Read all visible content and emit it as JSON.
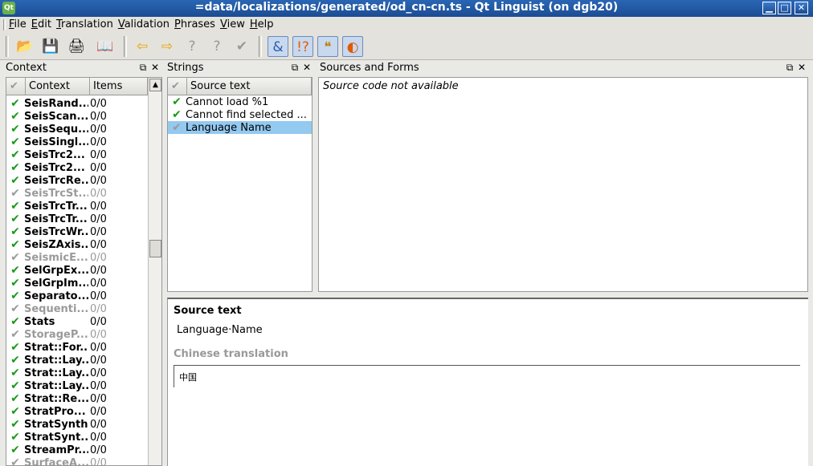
{
  "window": {
    "title": "=data/localizations/generated/od_cn-cn.ts - Qt Linguist (on dgb20)",
    "logo": "Qt"
  },
  "menu": [
    {
      "label": "File",
      "underline": "F",
      "rest": "ile"
    },
    {
      "label": "Edit",
      "underline": "E",
      "rest": "dit"
    },
    {
      "label": "Translation",
      "underline": "T",
      "rest": "ranslation"
    },
    {
      "label": "Validation",
      "underline": "V",
      "rest": "alidation"
    },
    {
      "label": "Phrases",
      "underline": "P",
      "rest": "hrases"
    },
    {
      "label": "View",
      "underline": "V",
      "rest": "iew"
    },
    {
      "label": "Help",
      "underline": "H",
      "rest": "elp"
    }
  ],
  "toolbar_icons": [
    "open-icon",
    "save-icon",
    "print-icon",
    "phrasebook-icon",
    "prev-icon",
    "next-icon",
    "prev-unfinished-icon",
    "next-unfinished-icon",
    "done-next-icon",
    "accelerators-icon",
    "punctuation-icon",
    "phrase-matches-icon",
    "place-markers-icon"
  ],
  "context_panel": {
    "title": "Context",
    "col_context": "Context",
    "col_items": "Items",
    "rows": [
      {
        "name": "SeisRand...",
        "items": "0/0",
        "state": "done"
      },
      {
        "name": "SeisScan...",
        "items": "0/0",
        "state": "done"
      },
      {
        "name": "SeisSequ...",
        "items": "0/0",
        "state": "done"
      },
      {
        "name": "SeisSingl...",
        "items": "0/0",
        "state": "done"
      },
      {
        "name": "SeisTrc2...",
        "items": "0/0",
        "state": "done"
      },
      {
        "name": "SeisTrc2...",
        "items": "0/0",
        "state": "done"
      },
      {
        "name": "SeisTrcRe...",
        "items": "0/0",
        "state": "done"
      },
      {
        "name": "SeisTrcSt...",
        "items": "0/0",
        "state": "obsolete"
      },
      {
        "name": "SeisTrcTr...",
        "items": "0/0",
        "state": "done"
      },
      {
        "name": "SeisTrcTr...",
        "items": "0/0",
        "state": "done"
      },
      {
        "name": "SeisTrcWr...",
        "items": "0/0",
        "state": "done"
      },
      {
        "name": "SeisZAxis...",
        "items": "0/0",
        "state": "done"
      },
      {
        "name": "SeismicE...",
        "items": "0/0",
        "state": "obsolete"
      },
      {
        "name": "SelGrpEx...",
        "items": "0/0",
        "state": "done"
      },
      {
        "name": "SelGrpIm...",
        "items": "0/0",
        "state": "done"
      },
      {
        "name": "Separato...",
        "items": "0/0",
        "state": "done"
      },
      {
        "name": "Sequenti...",
        "items": "0/0",
        "state": "obsolete"
      },
      {
        "name": "Stats",
        "items": "0/0",
        "state": "done"
      },
      {
        "name": "StorageP...",
        "items": "0/0",
        "state": "obsolete"
      },
      {
        "name": "Strat::For...",
        "items": "0/0",
        "state": "done"
      },
      {
        "name": "Strat::Lay...",
        "items": "0/0",
        "state": "done"
      },
      {
        "name": "Strat::Lay...",
        "items": "0/0",
        "state": "done"
      },
      {
        "name": "Strat::Lay...",
        "items": "0/0",
        "state": "done"
      },
      {
        "name": "Strat::Re...",
        "items": "0/0",
        "state": "done"
      },
      {
        "name": "StratPro...",
        "items": "0/0",
        "state": "done"
      },
      {
        "name": "StratSynth",
        "items": "0/0",
        "state": "done"
      },
      {
        "name": "StratSynt...",
        "items": "0/0",
        "state": "done"
      },
      {
        "name": "StreamPr...",
        "items": "0/0",
        "state": "done"
      },
      {
        "name": "SurfaceA...",
        "items": "0/0",
        "state": "obsolete"
      }
    ]
  },
  "strings_panel": {
    "title": "Strings",
    "col_source": "Source text",
    "rows": [
      {
        "text": "Cannot load %1",
        "state": "done",
        "selected": false
      },
      {
        "text": "Cannot find selected ...",
        "state": "done",
        "selected": false
      },
      {
        "text": "Language Name",
        "state": "gray",
        "selected": true
      }
    ]
  },
  "sources_panel": {
    "title": "Sources and Forms",
    "message": "Source code not available"
  },
  "editor": {
    "source_label": "Source text",
    "source_value": "Language·Name",
    "translation_label": "Chinese translation",
    "translation_value": "中国"
  }
}
